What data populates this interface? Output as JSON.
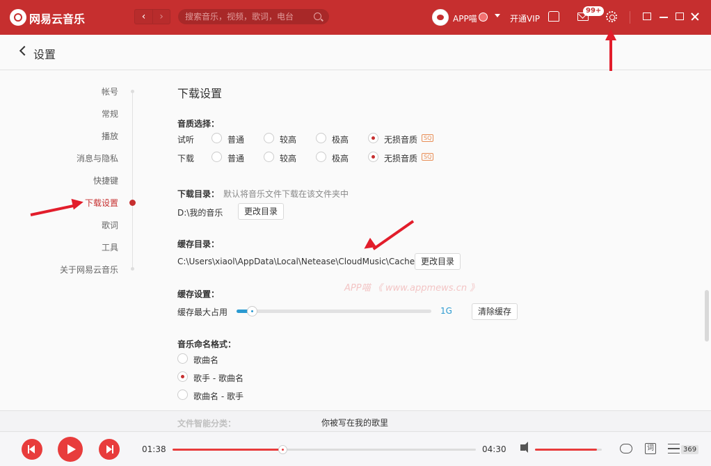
{
  "titlebar": {
    "app_title": "网易云音乐",
    "nav_back": "‹",
    "nav_forward": "›",
    "search_placeholder": "搜索音乐，视频，歌词，电台",
    "username": "APP喵",
    "vip_link": "开通VIP",
    "mail_badge": "99+",
    "accent_color": "#c62f2f"
  },
  "header": {
    "title": "设置"
  },
  "sidebar": {
    "items": [
      {
        "label": "帐号"
      },
      {
        "label": "常规"
      },
      {
        "label": "播放"
      },
      {
        "label": "消息与隐私"
      },
      {
        "label": "快捷键"
      },
      {
        "label": "下载设置"
      },
      {
        "label": "歌词"
      },
      {
        "label": "工具"
      },
      {
        "label": "关于网易云音乐"
      }
    ],
    "active_index": 5
  },
  "download": {
    "section_title": "下载设置",
    "quality": {
      "label": "音质选择：",
      "rows": [
        {
          "label": "试听",
          "options": [
            "普通",
            "较高",
            "极高",
            "无损音质"
          ],
          "selected": 3
        },
        {
          "label": "下载",
          "options": [
            "普通",
            "较高",
            "极高",
            "无损音质"
          ],
          "selected": 3
        }
      ],
      "sq_tag": "SQ"
    },
    "download_dir": {
      "label": "下载目录：",
      "hint": "默认将音乐文件下载在该文件夹中",
      "path": "D:\\我的音乐",
      "button": "更改目录"
    },
    "cache_dir": {
      "label": "缓存目录：",
      "path": "C:\\Users\\xiaol\\AppData\\Local\\Netease\\CloudMusic\\Cache",
      "button": "更改目录"
    },
    "cache_settings": {
      "label": "缓存设置：",
      "max_label": "缓存最大占用",
      "slider_fraction": 0.08,
      "value": "1G",
      "clear_button": "清除缓存"
    },
    "naming": {
      "label": "音乐命名格式：",
      "options": [
        "歌曲名",
        "歌手 - 歌曲名",
        "歌曲名 - 歌手"
      ],
      "selected": 1
    },
    "next_label": "文件智能分类："
  },
  "watermark": "APP喵 《 www.appmews.cn 》",
  "player": {
    "song_title": "你被写在我的歌里",
    "current_time": "01:38",
    "total_time": "04:30",
    "progress_fraction": 0.363,
    "volume_fraction": 0.93,
    "lyric_icon_label": "词",
    "playlist_count": "369"
  }
}
